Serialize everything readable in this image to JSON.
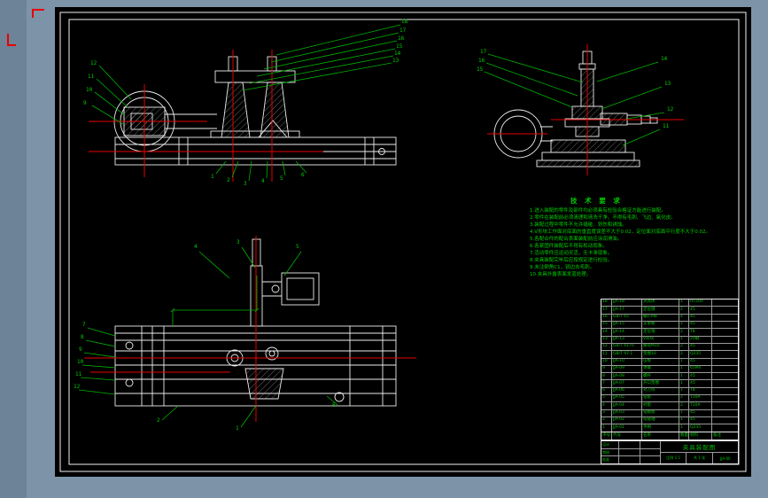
{
  "colors": {
    "desktop": "#7d93a8",
    "sheet": "#000000",
    "line_white": "#ededed",
    "accent_green": "#00c000",
    "accent_red": "#e60000"
  },
  "tech_requirements": {
    "title": "技 术 要 求",
    "lines": [
      "1.进入装配的零件及部件均必须具有检验合格证方能进行装配。",
      "2.零件在装配前必须清理和清洗干净，不得有毛刺、飞边、氧化皮。",
      "3.装配过程中零件不允许磕碰、划伤和锈蚀。",
      "4.V形块工作面对底面的垂直度误差不大于0.02，定位面对底面平行度不大于0.02。",
      "5.各配合件的配合表面装配前应涂润滑油。",
      "6.各紧固件装配后不得有松动现象。",
      "7.活动零件应运动灵活，无卡滞现象。",
      "8.夹具装配完毕后应按规定进行检验。",
      "9.未注倒角C1，锐边去毛刺。",
      "10.夹具外露表面发蓝处理。"
    ]
  },
  "balloons": {
    "tl_fan": [
      "18",
      "17",
      "16",
      "15",
      "14",
      "13"
    ],
    "tl_left": [
      "12",
      "11",
      "10",
      "9"
    ],
    "tl_bottom": [
      "1",
      "2",
      "3",
      "4",
      "5",
      "6"
    ],
    "tr_right": [
      "14",
      "13",
      "12",
      "11"
    ],
    "tr_left": [
      "17",
      "16",
      "15"
    ],
    "bl_top": [
      "4",
      "3",
      "5"
    ],
    "bl_left": [
      "7",
      "8",
      "9",
      "10",
      "11",
      "12"
    ],
    "bl_bottom": [
      "2",
      "1",
      "6"
    ]
  },
  "bom": {
    "header": {
      "no": "序号",
      "code": "代号",
      "name": "名称",
      "qty": "数量",
      "material": "材料",
      "remark": "备注"
    },
    "rows": [
      {
        "no": "18",
        "code": "JJA-18",
        "name": "夹具体",
        "qty": "1",
        "material": "HT200",
        "remark": ""
      },
      {
        "no": "17",
        "code": "JJA-17",
        "name": "定位键",
        "qty": "2",
        "material": "45",
        "remark": ""
      },
      {
        "no": "16",
        "code": "GB/T 65",
        "name": "螺钉M8",
        "qty": "4",
        "material": "45",
        "remark": ""
      },
      {
        "no": "15",
        "code": "JJA-15",
        "name": "支承板",
        "qty": "1",
        "material": "45",
        "remark": ""
      },
      {
        "no": "14",
        "code": "JJA-14",
        "name": "定位销",
        "qty": "2",
        "material": "T8",
        "remark": ""
      },
      {
        "no": "13",
        "code": "JJA-13",
        "name": "V形块",
        "qty": "1",
        "material": "20钢",
        "remark": ""
      },
      {
        "no": "12",
        "code": "GB/T 6170",
        "name": "螺母M10",
        "qty": "2",
        "material": "45",
        "remark": ""
      },
      {
        "no": "11",
        "code": "GB/T 97.1",
        "name": "垫圈10",
        "qty": "2",
        "material": "Q235",
        "remark": ""
      },
      {
        "no": "10",
        "code": "JJA-10",
        "name": "压板",
        "qty": "1",
        "material": "45",
        "remark": ""
      },
      {
        "no": "9",
        "code": "JJA-09",
        "name": "弹簧",
        "qty": "1",
        "material": "65Mn",
        "remark": ""
      },
      {
        "no": "8",
        "code": "JJA-08",
        "name": "螺杆",
        "qty": "1",
        "material": "45",
        "remark": ""
      },
      {
        "no": "7",
        "code": "JJA-07",
        "name": "开口垫圈",
        "qty": "1",
        "material": "45",
        "remark": ""
      },
      {
        "no": "6",
        "code": "JJA-06",
        "name": "对刀块",
        "qty": "1",
        "material": "T8",
        "remark": ""
      },
      {
        "no": "5",
        "code": "JJA-05",
        "name": "钻套",
        "qty": "2",
        "material": "T10A",
        "remark": ""
      },
      {
        "no": "4",
        "code": "JJA-04",
        "name": "衬套",
        "qty": "2",
        "material": "T10A",
        "remark": ""
      },
      {
        "no": "3",
        "code": "JJA-03",
        "name": "钻模板",
        "qty": "1",
        "material": "45",
        "remark": ""
      },
      {
        "no": "2",
        "code": "JJA-02",
        "name": "铰链轴",
        "qty": "1",
        "material": "45",
        "remark": ""
      },
      {
        "no": "1",
        "code": "JJA-01",
        "name": "手柄",
        "qty": "1",
        "material": "Q235",
        "remark": ""
      }
    ]
  },
  "title_block": {
    "signoff": [
      "设计",
      "审核",
      "批准"
    ],
    "title": "夹具装配图",
    "scale": "比例 1:1",
    "sheets": "共 1 张",
    "code": "JJA-00"
  }
}
